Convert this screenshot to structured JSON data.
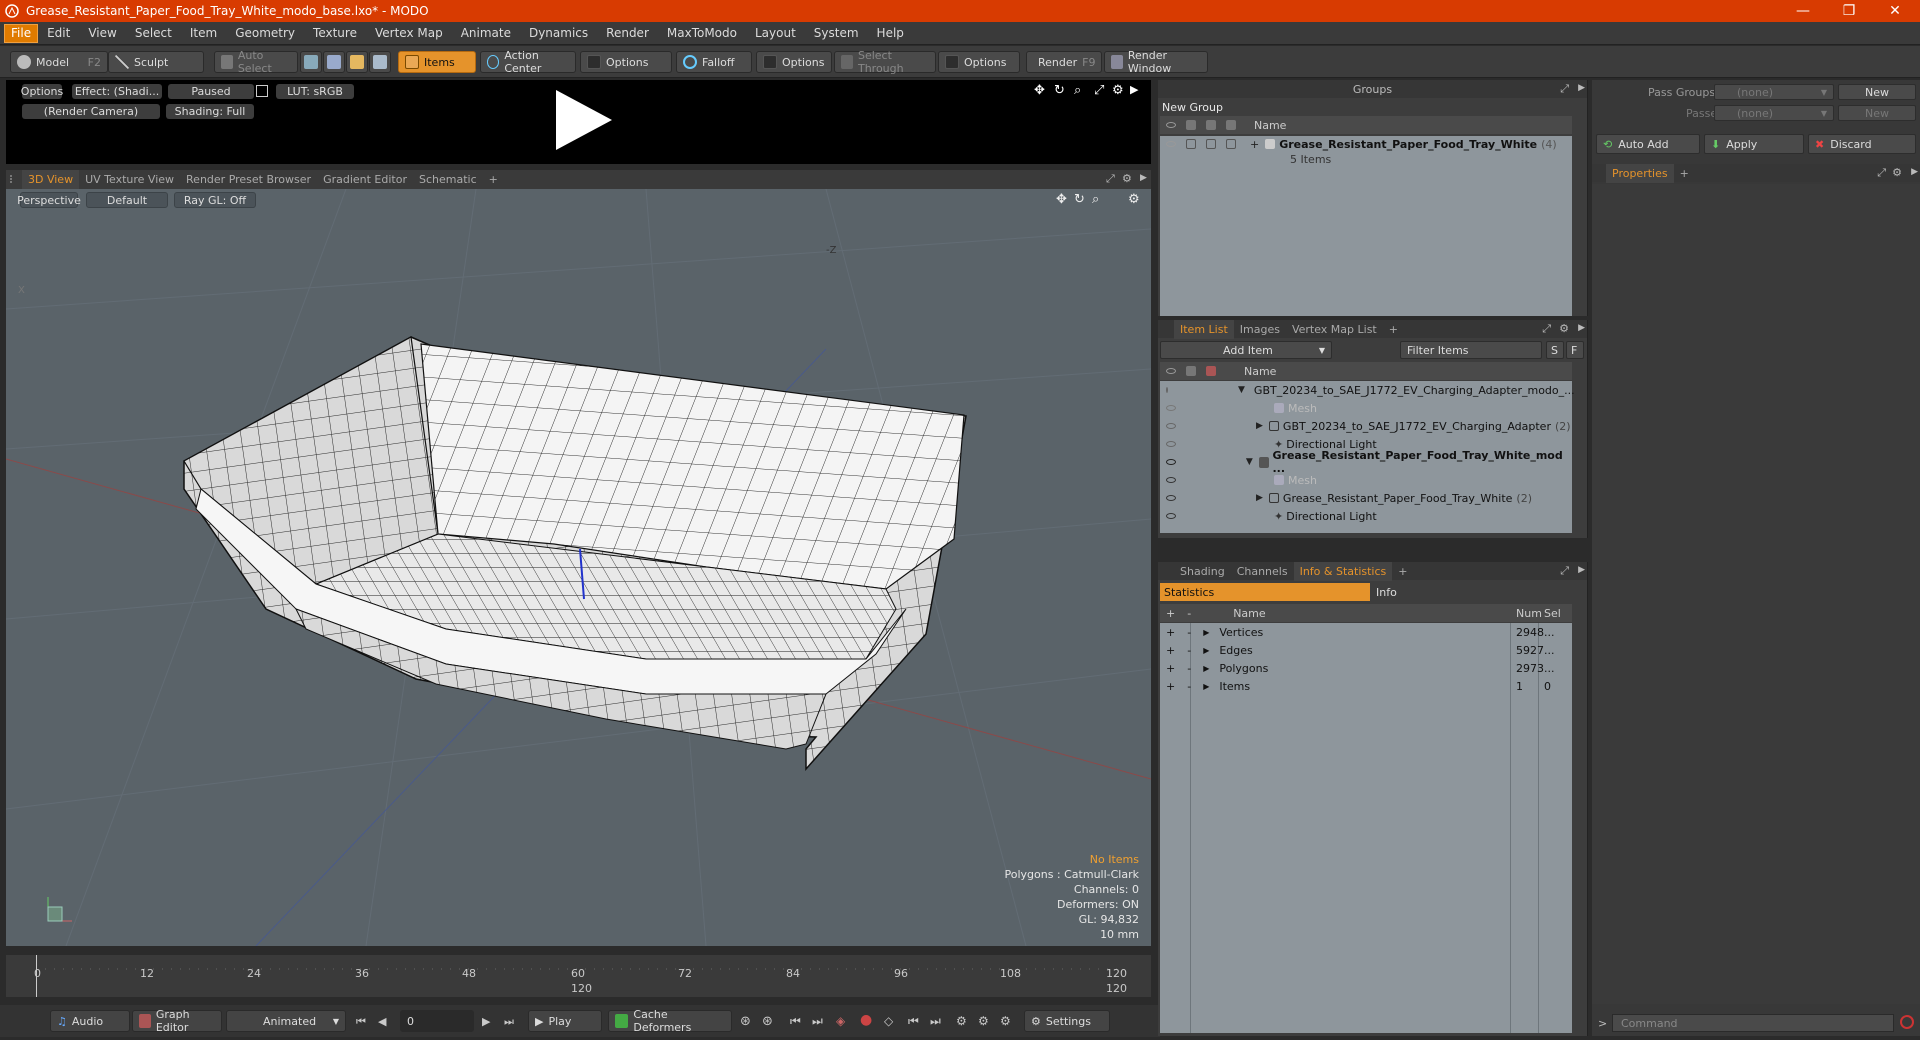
{
  "window": {
    "title": "Grease_Resistant_Paper_Food_Tray_White_modo_base.lxo* - MODO",
    "minimize": "—",
    "maximize": "❐",
    "close": "✕"
  },
  "menu": [
    "File",
    "Edit",
    "View",
    "Select",
    "Item",
    "Geometry",
    "Texture",
    "Vertex Map",
    "Animate",
    "Dynamics",
    "Render",
    "MaxToModo",
    "Layout",
    "System",
    "Help"
  ],
  "toolbar": {
    "model": "Model",
    "model_key": "F2",
    "sculpt": "Sculpt",
    "auto_select": "Auto Select",
    "items": "Items",
    "action_center": "Action Center",
    "options1": "Options",
    "falloff": "Falloff",
    "options2": "Options",
    "select_through": "Select Through",
    "options3": "Options",
    "render": "Render",
    "render_key": "F9",
    "render_window": "Render Window"
  },
  "preview": {
    "options": "Options",
    "effect": "Effect: (Shadi...",
    "paused": "Paused",
    "lut": "LUT: sRGB",
    "camera": "(Render Camera)",
    "shading": "Shading: Full"
  },
  "viewport_tabs": [
    "3D View",
    "UV Texture View",
    "Render Preset Browser",
    "Gradient Editor",
    "Schematic",
    "+"
  ],
  "viewport": {
    "projection": "Perspective",
    "style": "Default",
    "raygl": "Ray GL: Off",
    "axis_label": "-Z",
    "x_label": "X",
    "info": {
      "no_items": "No Items",
      "polygons": "Polygons : Catmull-Clark",
      "channels": "Channels: 0",
      "deformers": "Deformers: ON",
      "gl": "GL: 94,832",
      "scale": "10 mm"
    }
  },
  "timeline": {
    "ticks": [
      "0",
      "12",
      "24",
      "36",
      "48",
      "60",
      "72",
      "84",
      "96",
      "108",
      "120"
    ],
    "sub_60": "120",
    "sub_120": "120"
  },
  "bottombar": {
    "audio": "Audio",
    "graph_editor": "Graph Editor",
    "animated": "Animated",
    "frame": "0",
    "play": "Play",
    "cache": "Cache Deformers",
    "settings": "Settings"
  },
  "groups": {
    "title": "Groups",
    "new_group": "New Group",
    "col_name": "Name",
    "item_name": "Grease_Resistant_Paper_Food_Tray_White",
    "item_count": "(4)",
    "item_sub": "5 Items"
  },
  "itemlist": {
    "tabs": [
      "Item List",
      "Images",
      "Vertex Map List",
      "+"
    ],
    "add_item": "Add Item",
    "filter": "Filter Items",
    "s": "S",
    "f": "F",
    "col_name": "Name",
    "rows": [
      {
        "label": "GBT_20234_to_SAE_J1772_EV_Charging_Adapter_modo_...",
        "count": "",
        "bold": false
      },
      {
        "label": "Mesh",
        "count": "",
        "bold": false
      },
      {
        "label": "GBT_20234_to_SAE_J1772_EV_Charging_Adapter",
        "count": "(2)",
        "bold": false
      },
      {
        "label": "Directional Light",
        "count": "",
        "bold": false
      },
      {
        "label": "Grease_Resistant_Paper_Food_Tray_White_mod ...",
        "count": "",
        "bold": true
      },
      {
        "label": "Mesh",
        "count": "",
        "bold": false
      },
      {
        "label": "Grease_Resistant_Paper_Food_Tray_White",
        "count": "(2)",
        "bold": false
      },
      {
        "label": "Directional Light",
        "count": "",
        "bold": false
      }
    ]
  },
  "stats": {
    "tabs": [
      "Shading",
      "Channels",
      "Info & Statistics",
      "+"
    ],
    "sub_tabs": [
      "Statistics",
      "Info"
    ],
    "cols": {
      "name": "Name",
      "num": "Num",
      "sel": "Sel"
    },
    "rows": [
      {
        "name": "Vertices",
        "num": "2948",
        "sel": "..."
      },
      {
        "name": "Edges",
        "num": "5927",
        "sel": "..."
      },
      {
        "name": "Polygons",
        "num": "2973",
        "sel": "..."
      },
      {
        "name": "Items",
        "num": "1",
        "sel": "0"
      }
    ]
  },
  "passes": {
    "pass_groups": "Pass Groups",
    "passes": "Passes",
    "none1": "(none)",
    "none2": "(none)",
    "new1": "New",
    "new2": "New",
    "auto_add": "Auto Add",
    "apply": "Apply",
    "discard": "Discard",
    "properties": "Properties",
    "plus": "+"
  },
  "command": {
    "placeholder": "Command"
  },
  "colors": {
    "accent": "#e5932b",
    "title": "#d83b01",
    "viewport": "#5a6369"
  }
}
